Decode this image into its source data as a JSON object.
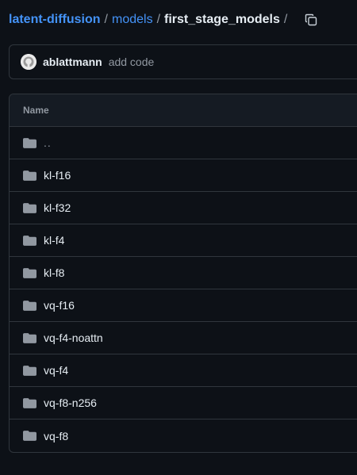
{
  "breadcrumb": {
    "repo": "latent-diffusion",
    "folder": "models",
    "current": "first_stage_models",
    "separator": "/"
  },
  "commit": {
    "author": "ablattmann",
    "message": "add code"
  },
  "table": {
    "header": "Name",
    "parent": "..",
    "rows": [
      {
        "name": "kl-f16"
      },
      {
        "name": "kl-f32"
      },
      {
        "name": "kl-f4"
      },
      {
        "name": "kl-f8"
      },
      {
        "name": "vq-f16"
      },
      {
        "name": "vq-f4-noattn"
      },
      {
        "name": "vq-f4"
      },
      {
        "name": "vq-f8-n256"
      },
      {
        "name": "vq-f8"
      }
    ]
  },
  "icons": {
    "copy": "copy-icon",
    "folder": "folder-icon",
    "avatar": "github-avatar"
  },
  "colors": {
    "background": "#0d1117",
    "link": "#4493f8",
    "text": "#e6edf3",
    "muted": "#9198a1",
    "border": "#30363d",
    "folder": "#9198a1"
  }
}
